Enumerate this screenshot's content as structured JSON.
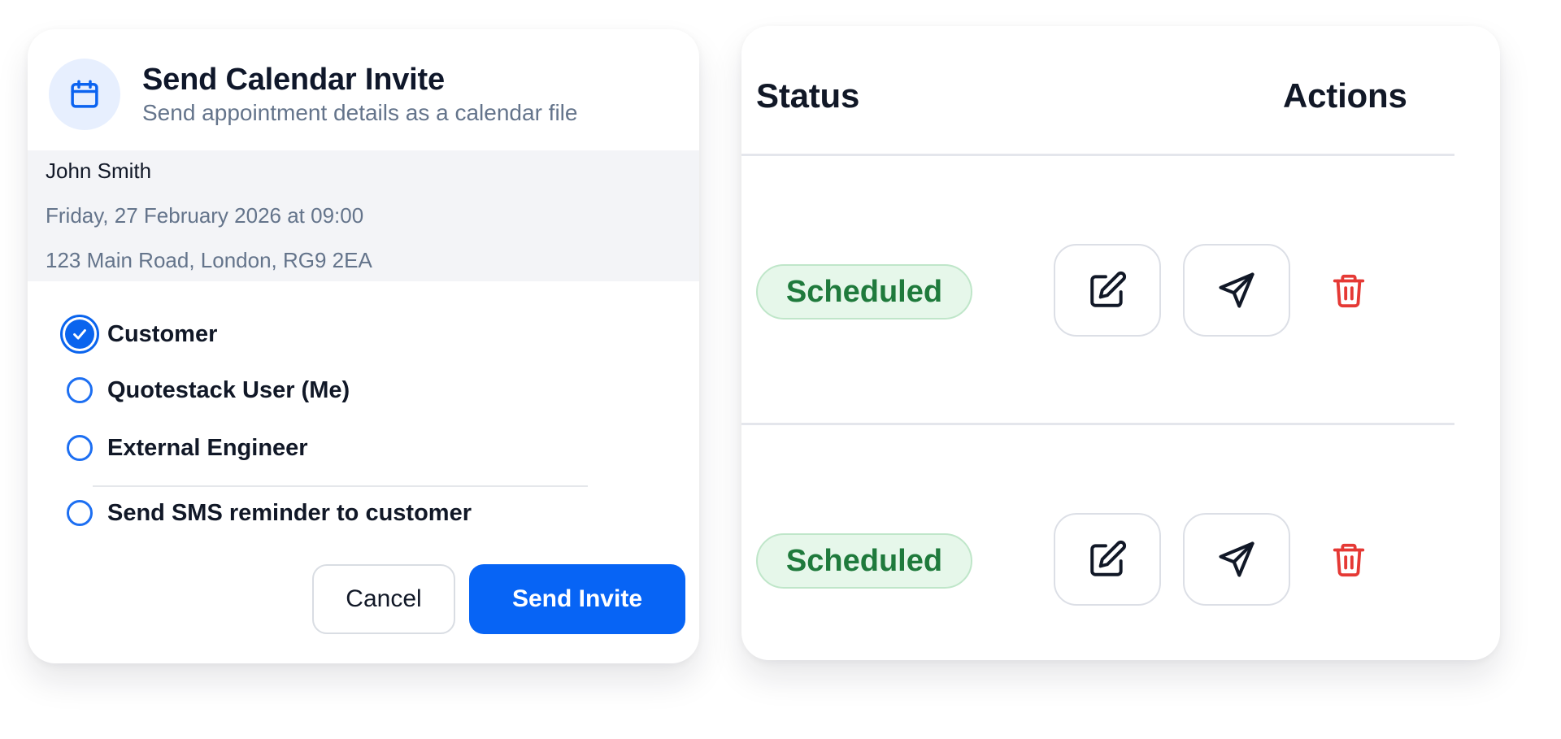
{
  "dialog": {
    "title": "Send Calendar Invite",
    "subtitle": "Send appointment details as a calendar file",
    "icon": "calendar-icon",
    "details": {
      "name": "John Smith",
      "datetime": "Friday, 27 February 2026 at 09:00",
      "address": "123 Main Road, London, RG9 2EA"
    },
    "recipients": [
      {
        "label": "Customer",
        "checked": true
      },
      {
        "label": "Quotestack User (Me)",
        "checked": false
      },
      {
        "label": "External Engineer",
        "checked": false
      }
    ],
    "sms_option": {
      "label": "Send SMS reminder to customer",
      "checked": false
    },
    "buttons": {
      "cancel": "Cancel",
      "send": "Send Invite"
    },
    "colors": {
      "primary": "#0764f5",
      "icon_bg": "#e7effe"
    }
  },
  "table": {
    "headers": {
      "status": "Status",
      "actions": "Actions"
    },
    "rows": [
      {
        "status": "Scheduled",
        "actions": [
          "edit-icon",
          "send-icon",
          "trash-icon"
        ]
      },
      {
        "status": "Scheduled",
        "actions": [
          "edit-icon",
          "send-icon",
          "trash-icon"
        ]
      }
    ],
    "colors": {
      "status_text": "#1f7a3c",
      "status_bg": "#e6f7ea",
      "delete": "#e53935"
    }
  }
}
